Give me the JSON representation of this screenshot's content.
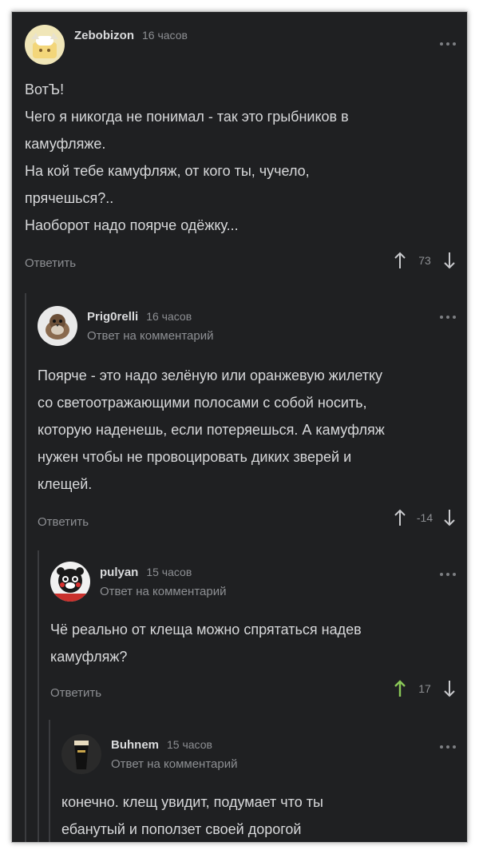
{
  "comments": [
    {
      "username": "Zebobizon",
      "time": "16 часов",
      "reply_to": "",
      "text_lines": [
        "ВотЪ!",
        "Чего я никогда не понимал - так это грыбников в",
        "камуфляже.",
        "На кой тебе камуфляж, от кого ты, чучело,",
        "прячешься?..",
        "Наоборот надо поярче одёжку..."
      ],
      "reply_label": "Ответить",
      "rating": "73",
      "upvoted": false
    },
    {
      "username": "Prig0relli",
      "time": "16 часов",
      "reply_to": "Ответ на комментарий",
      "text_lines": [
        "Поярче - это надо зелёную или оранжевую жилетку",
        "со светоотражающими полосами с собой носить,",
        "которую наденешь, если потеряешься. А камуфляж",
        "нужен чтобы не провоцировать диких зверей и",
        "клещей."
      ],
      "reply_label": "Ответить",
      "rating": "-14",
      "upvoted": false
    },
    {
      "username": "pulyan",
      "time": "15 часов",
      "reply_to": "Ответ на комментарий",
      "text_lines": [
        "Чё реально от клеща можно спрятаться надев",
        "камуфляж?"
      ],
      "reply_label": "Ответить",
      "rating": "17",
      "upvoted": true
    },
    {
      "username": "Buhnem",
      "time": "15 часов",
      "reply_to": "Ответ на комментарий",
      "text_lines": [
        "конечно. клещ увидит, подумает что ты",
        "ебанутый и поползет своей дорогой"
      ],
      "reply_label": "",
      "rating": "",
      "upvoted": false
    }
  ],
  "colors": {
    "background": "#1f2022",
    "text": "#d7d8da",
    "muted": "#8d8f93",
    "upvote_active": "#8ac858",
    "thread_line": "#3b3c3f"
  }
}
